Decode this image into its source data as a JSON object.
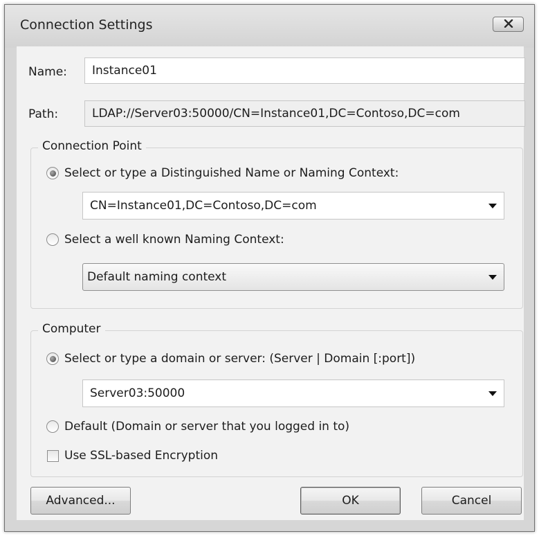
{
  "window": {
    "title": "Connection Settings"
  },
  "fields": {
    "name_label": "Name:",
    "name_value": "Instance01",
    "path_label": "Path:",
    "path_value": "LDAP://Server03:50000/CN=Instance01,DC=Contoso,DC=com"
  },
  "connection_point": {
    "title": "Connection Point",
    "option_dn_label": "Select or type a Distinguished Name or Naming Context:",
    "option_dn_selected": true,
    "dn_value": "CN=Instance01,DC=Contoso,DC=com",
    "option_known_label": "Select a well known Naming Context:",
    "option_known_selected": false,
    "known_value": "Default naming context"
  },
  "computer": {
    "title": "Computer",
    "option_server_label": "Select or type a domain or server: (Server | Domain [:port])",
    "option_server_selected": true,
    "server_value": "Server03:50000",
    "option_default_label": "Default (Domain or server that you logged in to)",
    "option_default_selected": false,
    "ssl_label": "Use SSL-based Encryption",
    "ssl_checked": false
  },
  "buttons": {
    "advanced": "Advanced...",
    "ok": "OK",
    "cancel": "Cancel"
  }
}
